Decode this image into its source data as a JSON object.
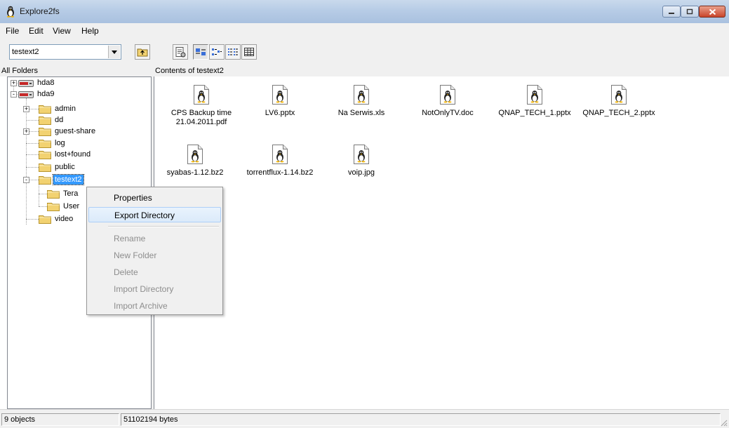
{
  "window": {
    "title": "Explore2fs",
    "icon": "tux-penguin-icon"
  },
  "menu": [
    "File",
    "Edit",
    "View",
    "Help"
  ],
  "toolbar": {
    "drive_selected": "testext2",
    "buttons": [
      "up-folder-icon",
      "properties-icon",
      "large-icons-view-icon",
      "small-icons-view-icon",
      "list-view-icon",
      "details-view-icon"
    ]
  },
  "folders_header": "All Folders",
  "contents_header": "Contents of testext2",
  "tree": [
    {
      "label": "hda8",
      "type": "drive",
      "expander": "+"
    },
    {
      "label": "hda9",
      "type": "drive",
      "expander": "-"
    },
    {
      "label": "admin",
      "type": "folder",
      "expander": "+"
    },
    {
      "label": "dd",
      "type": "folder"
    },
    {
      "label": "guest-share",
      "type": "folder",
      "expander": "+"
    },
    {
      "label": "log",
      "type": "folder"
    },
    {
      "label": "lost+found",
      "type": "folder"
    },
    {
      "label": "public",
      "type": "folder"
    },
    {
      "label": "testext2",
      "type": "folder",
      "expander": "-",
      "selected": true
    },
    {
      "label": "Tera",
      "type": "folder"
    },
    {
      "label": "User",
      "type": "folder"
    },
    {
      "label": "video",
      "type": "folder"
    }
  ],
  "files": [
    {
      "name": "CPS Backup time 21.04.2011.pdf",
      "line1": "CPS Backup time",
      "line2": "21.04.2011.pdf"
    },
    {
      "name": "LV6.pptx",
      "line1": "LV6.pptx",
      "line2": ""
    },
    {
      "name": "Na Serwis.xls",
      "line1": "Na Serwis.xls",
      "line2": ""
    },
    {
      "name": "NotOnlyTV.doc",
      "line1": "NotOnlyTV.doc",
      "line2": ""
    },
    {
      "name": "QNAP_TECH_1.pptx",
      "line1": "QNAP_TECH_1.pptx",
      "line2": ""
    },
    {
      "name": "QNAP_TECH_2.pptx",
      "line1": "QNAP_TECH_2.pptx",
      "line2": ""
    },
    {
      "name": "syabas-1.12.bz2",
      "line1": "syabas-1.12.bz2",
      "line2": ""
    },
    {
      "name": "torrentflux-1.14.bz2",
      "line1": "torrentflux-1.14.bz2",
      "line2": ""
    },
    {
      "name": "voip.jpg",
      "line1": "voip.jpg",
      "line2": ""
    }
  ],
  "context_menu": {
    "items": [
      {
        "label": "Properties",
        "enabled": true
      },
      {
        "label": "Export Directory",
        "enabled": true,
        "highlighted": true
      },
      {
        "label": "Rename",
        "enabled": false
      },
      {
        "label": "New Folder",
        "enabled": false
      },
      {
        "label": "Delete",
        "enabled": false
      },
      {
        "label": "Import Directory",
        "enabled": false
      },
      {
        "label": "Import Archive",
        "enabled": false
      }
    ]
  },
  "status": {
    "objects": "9 objects",
    "bytes": "51102194 bytes"
  },
  "colors": {
    "selection": "#3399ff",
    "folder": "#f2d271",
    "titlebar": "#b7cce6",
    "menu_highlight": "#dbeafa"
  }
}
